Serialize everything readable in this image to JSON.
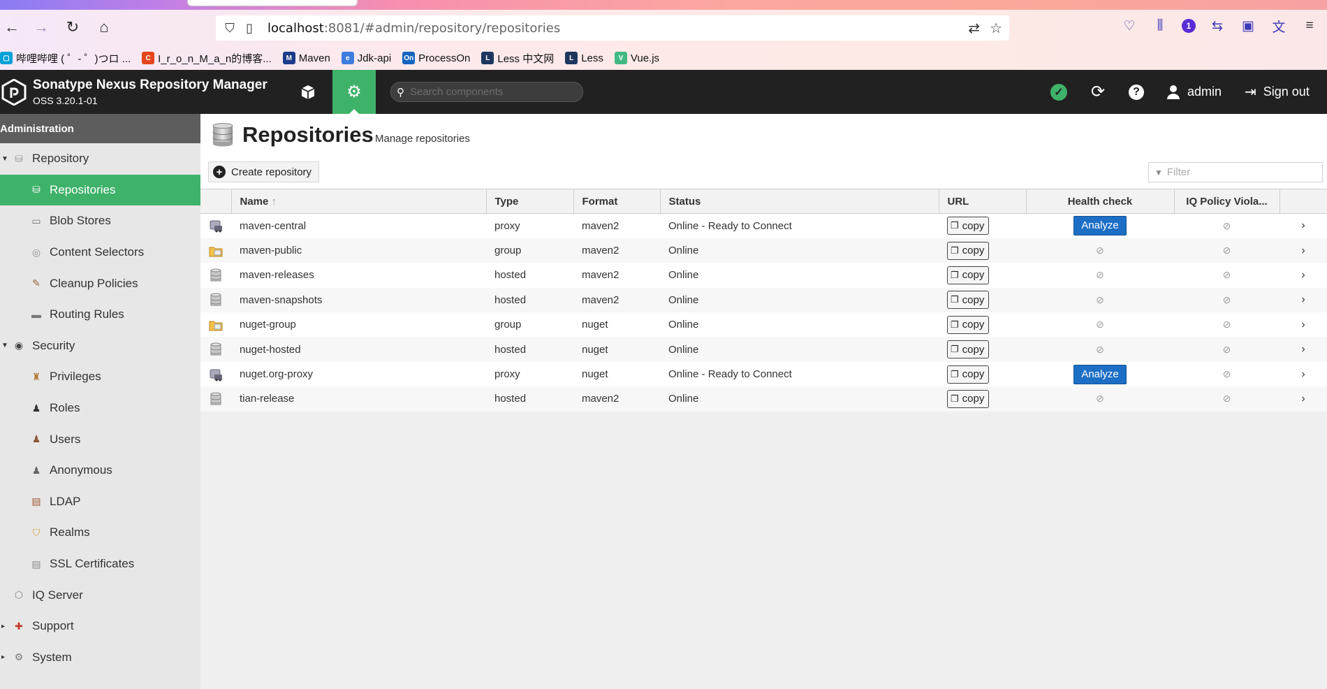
{
  "browser": {
    "url_host": "localhost",
    "url_path": ":8081/#admin/repository/repositories",
    "bookmarks": [
      {
        "label": "哔哩哔哩 ( ゜- ゜)つロ ...",
        "color": "#00a1d6",
        "glyph": "▢"
      },
      {
        "label": "I_r_o_n_M_a_n的博客...",
        "color": "#e4461c",
        "glyph": "C"
      },
      {
        "label": "Maven",
        "color": "#1b3c8a",
        "glyph": "M"
      },
      {
        "label": "Jdk-api",
        "color": "#3d7de0",
        "glyph": "e"
      },
      {
        "label": "ProcessOn",
        "color": "#1565c0",
        "glyph": "On"
      },
      {
        "label": "Less 中文网",
        "color": "#1d365d",
        "glyph": "L"
      },
      {
        "label": "Less",
        "color": "#1d365d",
        "glyph": "L"
      },
      {
        "label": "Vue.js",
        "color": "#41b883",
        "glyph": "V"
      }
    ],
    "badge_count": "1"
  },
  "header": {
    "title": "Sonatype Nexus Repository Manager",
    "version": "OSS 3.20.1-01",
    "search_placeholder": "Search components",
    "user": "admin",
    "signout": "Sign out"
  },
  "sidebar": {
    "heading": "Administration",
    "items": [
      {
        "label": "Repository",
        "level": 0,
        "icon": "database-icon",
        "expand": "▼"
      },
      {
        "label": "Repositories",
        "level": 1,
        "icon": "database-icon",
        "selected": true
      },
      {
        "label": "Blob Stores",
        "level": 1,
        "icon": "drive-icon"
      },
      {
        "label": "Content Selectors",
        "level": 1,
        "icon": "selector-icon"
      },
      {
        "label": "Cleanup Policies",
        "level": 1,
        "icon": "broom-icon"
      },
      {
        "label": "Routing Rules",
        "level": 1,
        "icon": "routing-icon"
      },
      {
        "label": "Security",
        "level": 0,
        "icon": "security-icon",
        "expand": "▼"
      },
      {
        "label": "Privileges",
        "level": 1,
        "icon": "privileges-icon"
      },
      {
        "label": "Roles",
        "level": 1,
        "icon": "roles-icon"
      },
      {
        "label": "Users",
        "level": 1,
        "icon": "users-icon"
      },
      {
        "label": "Anonymous",
        "level": 1,
        "icon": "anonymous-icon"
      },
      {
        "label": "LDAP",
        "level": 1,
        "icon": "ldap-icon"
      },
      {
        "label": "Realms",
        "level": 1,
        "icon": "shield-icon"
      },
      {
        "label": "SSL Certificates",
        "level": 1,
        "icon": "certificate-icon"
      },
      {
        "label": "IQ Server",
        "level": 0,
        "icon": "iq-server-icon"
      },
      {
        "label": "Support",
        "level": 0,
        "icon": "support-icon",
        "expand": "▸"
      },
      {
        "label": "System",
        "level": 0,
        "icon": "gear-icon",
        "expand": "▸"
      }
    ]
  },
  "page": {
    "title": "Repositories",
    "subtitle": "Manage repositories",
    "create_label": "Create repository",
    "filter_placeholder": "Filter"
  },
  "table": {
    "columns": [
      "Name",
      "Type",
      "Format",
      "Status",
      "URL",
      "Health check",
      "IQ Policy Viola..."
    ],
    "copy_label": "copy",
    "analyze_label": "Analyze",
    "rows": [
      {
        "name": "maven-central",
        "type": "proxy",
        "format": "maven2",
        "status": "Online - Ready to Connect",
        "health": "analyze"
      },
      {
        "name": "maven-public",
        "type": "group",
        "format": "maven2",
        "status": "Online",
        "health": "none"
      },
      {
        "name": "maven-releases",
        "type": "hosted",
        "format": "maven2",
        "status": "Online",
        "health": "none"
      },
      {
        "name": "maven-snapshots",
        "type": "hosted",
        "format": "maven2",
        "status": "Online",
        "health": "none"
      },
      {
        "name": "nuget-group",
        "type": "group",
        "format": "nuget",
        "status": "Online",
        "health": "none"
      },
      {
        "name": "nuget-hosted",
        "type": "hosted",
        "format": "nuget",
        "status": "Online",
        "health": "none"
      },
      {
        "name": "nuget.org-proxy",
        "type": "proxy",
        "format": "nuget",
        "status": "Online - Ready to Connect",
        "health": "analyze"
      },
      {
        "name": "tian-release",
        "type": "hosted",
        "format": "maven2",
        "status": "Online",
        "health": "none"
      }
    ]
  },
  "colors": {
    "accent": "#3fb26a",
    "header_bg": "#212121",
    "analyze": "#1d6fc6"
  }
}
